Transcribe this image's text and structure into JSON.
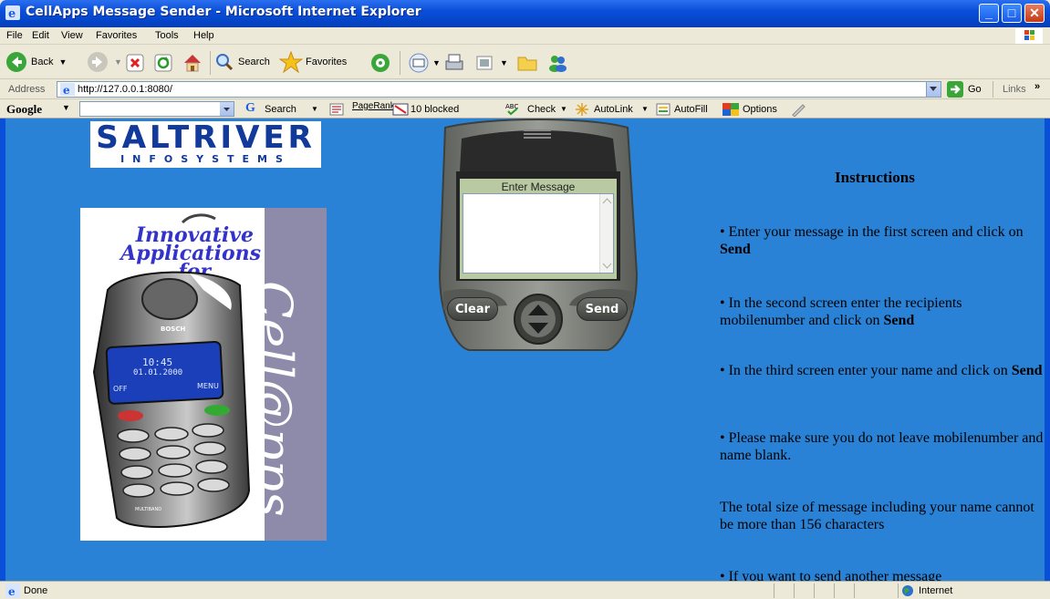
{
  "window": {
    "title": "CellApps Message Sender - Microsoft Internet Explorer",
    "buttons": {
      "minimize": "_",
      "maximize": "□",
      "close": "✕"
    }
  },
  "menu": [
    "File",
    "Edit",
    "View",
    "Favorites",
    "Tools",
    "Help"
  ],
  "toolbar": {
    "back_label": "Back",
    "search_label": "Search",
    "favorites_label": "Favorites"
  },
  "address": {
    "label": "Address",
    "url": "http://127.0.0.1:8080/",
    "go_label": "Go",
    "links_label": "Links"
  },
  "googlebar": {
    "brand": "Google",
    "search_label": "Search",
    "pagerank_label": "PageRank",
    "blocked_label": "10 blocked",
    "check_label": "Check",
    "autolink_label": "AutoLink",
    "autofill_label": "AutoFill",
    "options_label": "Options"
  },
  "logo": {
    "title": "SALTRIVER",
    "subtitle": "INFOSYSTEMS"
  },
  "promo": {
    "line1": "Innovative",
    "line2": "Applications",
    "line3": "for",
    "vertical": "Cell@pps",
    "phone_brand": "BOSCH",
    "phone_time": "10:45",
    "phone_date": "01.01.2000",
    "phone_off": "OFF",
    "phone_menu": "MENU",
    "phone_model": "MULTIBAND"
  },
  "phone_ui": {
    "screen_label": "Enter Message",
    "message_value": "",
    "clear_label": "Clear",
    "send_label": "Send"
  },
  "instructions": {
    "heading": "Instructions",
    "items": [
      {
        "lead": "• Enter your message in the first screen and click on ",
        "bold": "Send"
      },
      {
        "lead": "• In the second screen enter the recipients mobilenumber and click on ",
        "bold": "Send"
      },
      {
        "lead": "• In the third screen enter your name and click on ",
        "bold": "Send"
      },
      {
        "lead": "• Please make sure you do not leave mobilenumber and name blank.",
        "bold": ""
      },
      {
        "lead": "The total size of message including your name cannot be more than 156 characters",
        "bold": ""
      },
      {
        "lead": "• If you want to send another message",
        "bold": ""
      }
    ]
  },
  "status": {
    "text": "Done",
    "zone": "Internet"
  },
  "colors": {
    "page_background": "#2a82d6",
    "titlebar": "#0a4fd8",
    "phone_body": "#7d7f7a",
    "phone_screen": "#b9caa3"
  }
}
